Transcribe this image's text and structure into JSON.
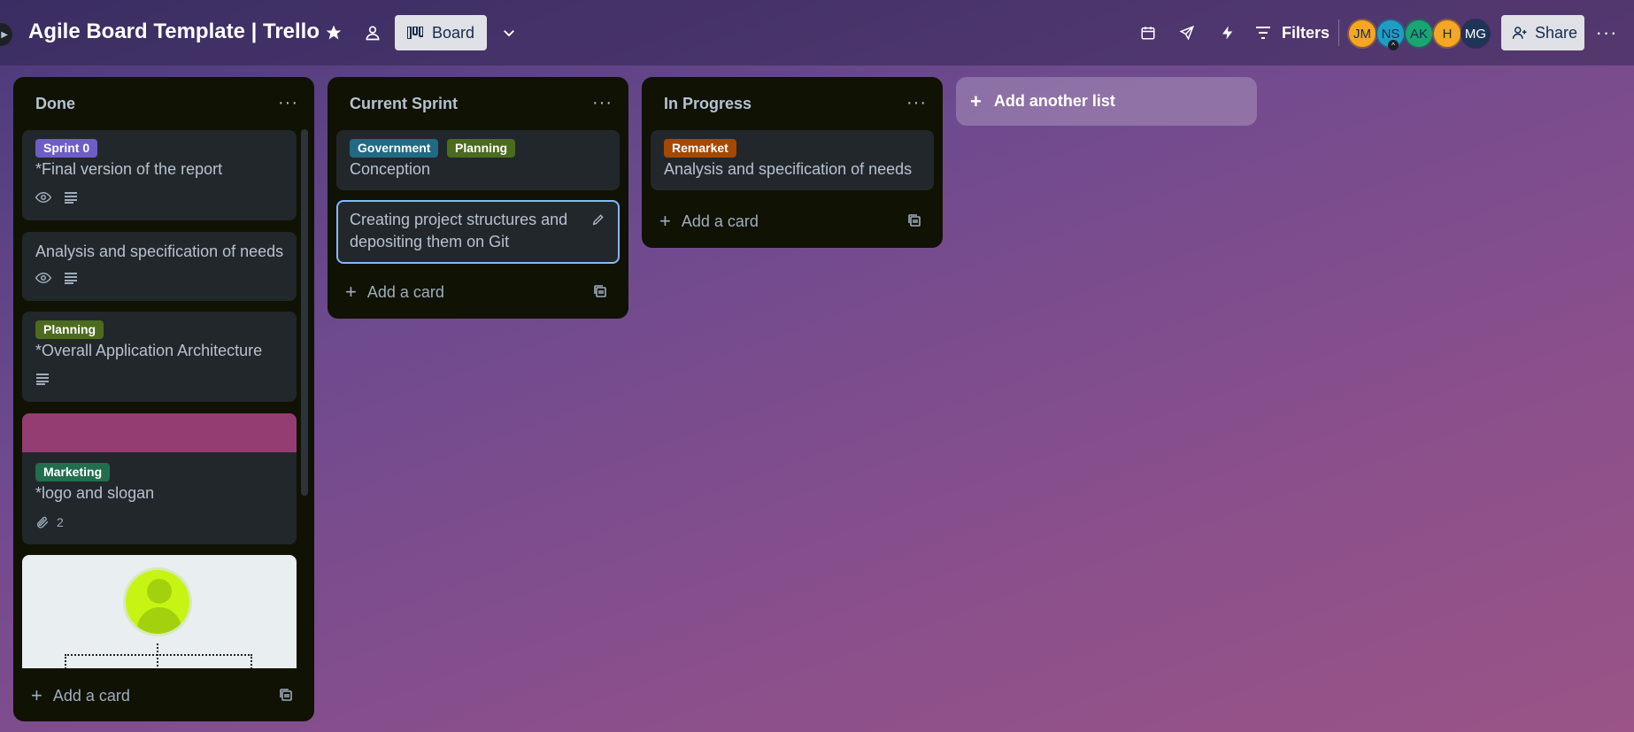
{
  "header": {
    "board_title": "Agile Board Template | Trello",
    "view_button": "Board",
    "filters_label": "Filters",
    "share_label": "Share",
    "members": [
      {
        "initials": "JM",
        "color": "#f5a623"
      },
      {
        "initials": "NS",
        "color": "#1e9ec4"
      },
      {
        "initials": "AK",
        "color": "#1aa672"
      },
      {
        "initials": "H",
        "color": "#f5a623"
      },
      {
        "initials": "MG",
        "color": "#1d3557"
      }
    ]
  },
  "lists": [
    {
      "title": "Done",
      "add_card": "Add a card",
      "cards": [
        {
          "label": "Sprint 0",
          "label_color": "#6e5dc6",
          "title": "*Final version of the report",
          "badges": [
            "watch-icon",
            "description-icon"
          ]
        },
        {
          "title": "Analysis and specification of needs",
          "badges": [
            "watch-icon",
            "description-icon"
          ]
        },
        {
          "label": "Planning",
          "label_color": "#4c6b1f",
          "title": "*Overall Application Architecture",
          "badges": [
            "description-icon"
          ]
        },
        {
          "cover_color": "#943d73",
          "label": "Marketing",
          "label_color": "#216e4e",
          "title": "*logo and slogan",
          "attachments": "2"
        },
        {
          "cover": "image-preview"
        }
      ]
    },
    {
      "title": "Current Sprint",
      "add_card": "Add a card",
      "cards": [
        {
          "labels": [
            {
              "text": "Government",
              "color": "#206a83"
            },
            {
              "text": "Planning",
              "color": "#4c6b1f"
            }
          ],
          "title": "Conception"
        },
        {
          "title": "Creating project structures and depositing them on Git"
        }
      ]
    },
    {
      "title": "In Progress",
      "add_card": "Add a card",
      "cards": [
        {
          "label": "Remarket",
          "label_color": "#a54800",
          "title": "Analysis and specification of needs"
        }
      ]
    }
  ],
  "add_list": "Add another list"
}
